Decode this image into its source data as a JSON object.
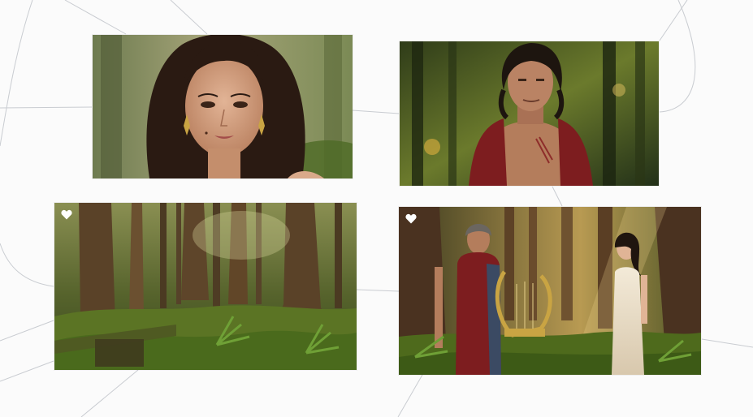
{
  "canvas": {
    "background": "#fbfbfb",
    "edge_color": "#c9ccd1"
  },
  "cards": [
    {
      "name": "woman-portrait",
      "favorited": false
    },
    {
      "name": "man-portrait",
      "favorited": false
    },
    {
      "name": "forest-landscape",
      "favorited": true
    },
    {
      "name": "forest-scene-with-lyre",
      "favorited": true
    }
  ],
  "icons": {
    "favorite": "heart-icon"
  },
  "colors": {
    "heart": "#ffffff",
    "forest_dark": "#1f2b14",
    "forest_light": "#6f8a34",
    "robe": "#7d1d1f",
    "lyre": "#c9a443"
  }
}
